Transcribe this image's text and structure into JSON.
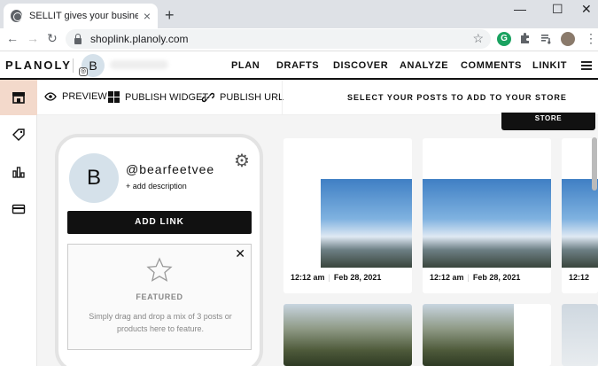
{
  "browser": {
    "tab_title": "SELLIT gives your business a sto",
    "tab_close": "×",
    "new_tab": "+",
    "url": "shoplink.planoly.com",
    "window_min": "—",
    "window_max": "☐",
    "window_close": "✕"
  },
  "header": {
    "logo": "PLANOLY",
    "account_initial": "B",
    "nav": [
      "PLAN",
      "DRAFTS",
      "DISCOVER",
      "ANALYZE",
      "COMMENTS",
      "LINKIT"
    ]
  },
  "subbar": {
    "preview": "PREVIEW",
    "publish_widget": "PUBLISH WIDGET",
    "publish_url": "PUBLISH URL",
    "select_posts": "SELECT YOUR POSTS TO ADD TO YOUR STORE"
  },
  "profile": {
    "initial": "B",
    "handle": "@bearfeetvee",
    "description": "+ add description",
    "add_link": "ADD LINK",
    "featured_title": "FEATURED",
    "featured_help": "Simply drag and drop a mix of 3 posts or products here to feature.",
    "featured_close": "✕"
  },
  "store_button": "STORE",
  "posts": [
    {
      "time": "12:12 am",
      "date": "Feb 28, 2021"
    },
    {
      "time": "12:12 am",
      "date": "Feb 28, 2021"
    },
    {
      "time": "12:12",
      "date": ""
    }
  ],
  "colors": {
    "rail_active": "#f3d9cb",
    "primary": "#111111"
  }
}
